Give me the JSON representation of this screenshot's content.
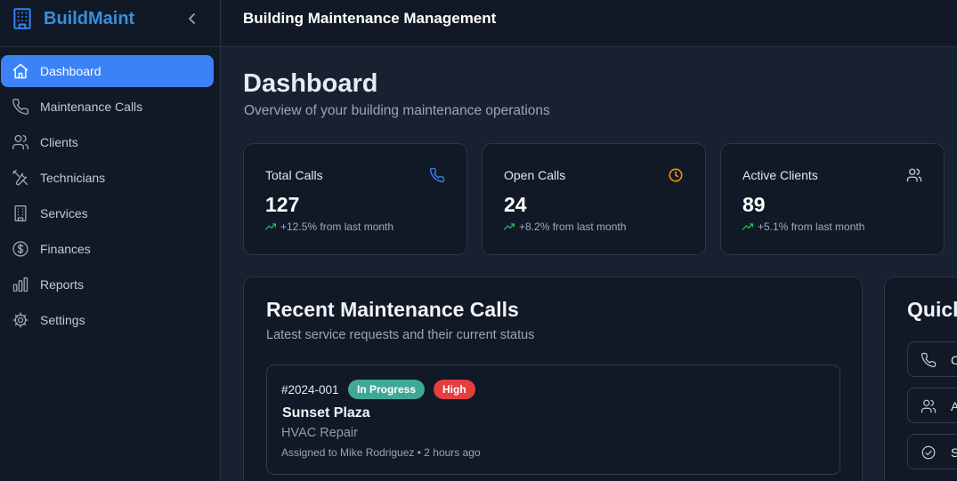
{
  "brand": {
    "name": "BuildMaint"
  },
  "header": {
    "title": "Building Maintenance Management"
  },
  "sidebar": {
    "items": [
      {
        "label": "Dashboard",
        "icon": "home-icon",
        "active": true
      },
      {
        "label": "Maintenance Calls",
        "icon": "phone-icon"
      },
      {
        "label": "Clients",
        "icon": "users-icon"
      },
      {
        "label": "Technicians",
        "icon": "tools-icon"
      },
      {
        "label": "Services",
        "icon": "building-icon"
      },
      {
        "label": "Finances",
        "icon": "dollar-icon"
      },
      {
        "label": "Reports",
        "icon": "bar-chart-icon"
      },
      {
        "label": "Settings",
        "icon": "gear-icon"
      }
    ]
  },
  "page": {
    "title": "Dashboard",
    "subtitle": "Overview of your building maintenance operations"
  },
  "stats": [
    {
      "label": "Total Calls",
      "value": "127",
      "trend": "+12.5% from last month",
      "icon": "phone-icon",
      "icon_color": "#3b82f6"
    },
    {
      "label": "Open Calls",
      "value": "24",
      "trend": "+8.2% from last month",
      "icon": "clock-icon",
      "icon_color": "#f59e0b"
    },
    {
      "label": "Active Clients",
      "value": "89",
      "trend": "+5.1% from last month",
      "icon": "users-icon",
      "icon_color": "#c3cad6"
    }
  ],
  "recent": {
    "title": "Recent Maintenance Calls",
    "subtitle": "Latest service requests and their current status",
    "calls": [
      {
        "id": "#2024-001",
        "status": "In Progress",
        "priority": "High",
        "building": "Sunset Plaza",
        "service": "HVAC Repair",
        "meta": "Assigned to Mike Rodriguez • 2 hours ago"
      }
    ]
  },
  "quick_actions": {
    "title": "Quick",
    "buttons": [
      {
        "label": "C",
        "icon": "phone-icon"
      },
      {
        "label": "A",
        "icon": "users-icon"
      },
      {
        "label": "S",
        "icon": "check-circle-icon"
      }
    ]
  },
  "colors": {
    "accent": "#3b82f6",
    "brand": "#3b8fd8",
    "status_in_progress": "#3fa896",
    "priority_high": "#e53e3e",
    "trend_up": "#22c55e"
  }
}
